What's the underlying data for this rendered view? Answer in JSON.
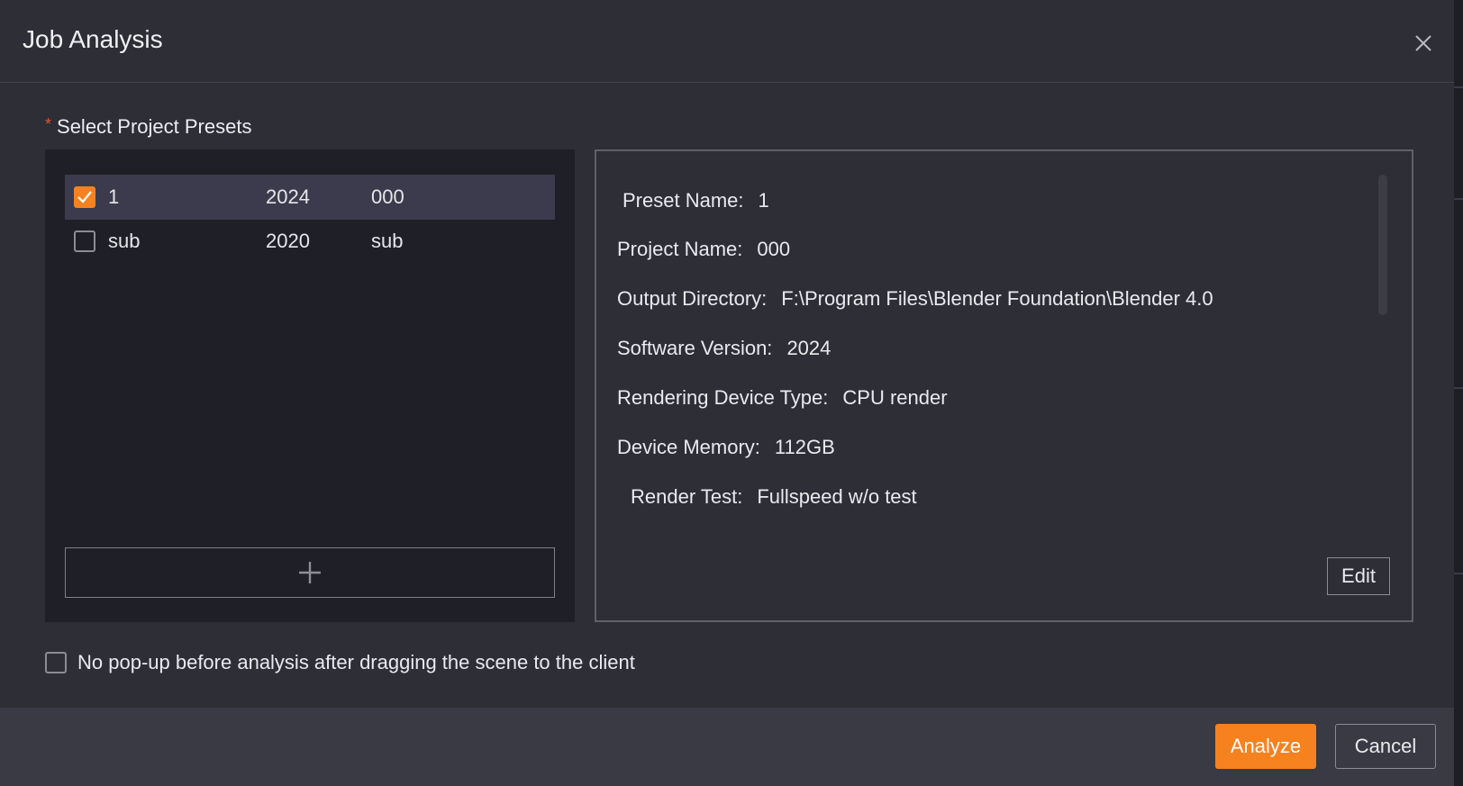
{
  "dialog": {
    "title": "Job Analysis",
    "close_icon": "close-icon"
  },
  "presets": {
    "required_mark": "*",
    "label": "Select Project Presets",
    "items": [
      {
        "name": "1",
        "version": "2024",
        "project": "000",
        "checked": true
      },
      {
        "name": "sub",
        "version": "2020",
        "project": "sub",
        "checked": false
      }
    ],
    "add_icon": "plus-icon"
  },
  "details": {
    "preset_name": {
      "label": "Preset Name:",
      "value": "1"
    },
    "project_name": {
      "label": "Project Name:",
      "value": "000"
    },
    "output_directory": {
      "label": "Output Directory:",
      "value": "F:\\Program Files\\Blender Foundation\\Blender 4.0"
    },
    "software_version": {
      "label": "Software Version:",
      "value": "2024"
    },
    "rendering_device_type": {
      "label": "Rendering Device Type:",
      "value": "CPU render"
    },
    "device_memory": {
      "label": "Device Memory:",
      "value": "112GB"
    },
    "render_test": {
      "label": "Render Test:",
      "value": "Fullspeed w/o test"
    },
    "edit_label": "Edit"
  },
  "options": {
    "no_popup_label": "No pop-up before analysis after dragging the scene to the client",
    "no_popup_checked": false
  },
  "footer": {
    "analyze_label": "Analyze",
    "cancel_label": "Cancel"
  },
  "colors": {
    "accent": "#f5821f",
    "background": "#2d2e36",
    "panel": "#1f2027",
    "selected_row": "#3b3b4d"
  }
}
